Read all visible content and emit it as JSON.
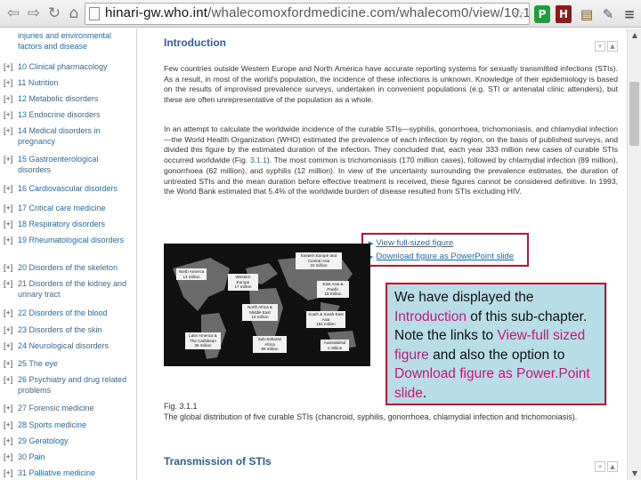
{
  "browser": {
    "url_host": "hinari-gw.who.int",
    "url_path": "/whalecomoxfordmedicine.com/whalecom0/view/10.1093/m",
    "ext_p_label": "P",
    "ext_h_label": "H"
  },
  "sidebar": {
    "expander": "[+]",
    "top_fragment": "injuries and environmental factors and disease",
    "items": [
      {
        "label": "10 Clinical pharmacology"
      },
      {
        "label": "11 Nutrition"
      },
      {
        "label": "12 Metabolic disorders"
      },
      {
        "label": "13 Endocrine disorders"
      },
      {
        "label": "14 Medical disorders in pregnancy"
      },
      {
        "label": "15 Gastroenterological disorders"
      },
      {
        "label": "16 Cardiovascular disorders"
      },
      {
        "label": "17 Critical care medicine"
      },
      {
        "label": "18 Respiratory disorders"
      },
      {
        "label": "19 Rheumatological disorders"
      },
      {
        "label": "20 Disorders of the skeleton"
      },
      {
        "label": "21 Disorders of the kidney and urinary tract"
      },
      {
        "label": "22 Disorders of the blood"
      },
      {
        "label": "23 Disorders of the skin"
      },
      {
        "label": "24 Neurological disorders"
      },
      {
        "label": "25 The eye"
      },
      {
        "label": "26 Psychiatry and drug related problems"
      },
      {
        "label": "27 Forensic medicine"
      },
      {
        "label": "28 Sports medicine"
      },
      {
        "label": "29 Geratology"
      },
      {
        "label": "30 Pain"
      },
      {
        "label": "31 Palliative medicine"
      }
    ]
  },
  "content": {
    "intro_title": "Introduction",
    "para1": "Few countries outside Western Europe and North America have accurate reporting systems for sexually transmitted infections (STIs). As a result, in most of the world's population, the incidence of these infections is unknown. Knowledge of their epidemiology is based on the results of improvised prevalence surveys, undertaken in convenient populations (e.g. STI or antenatal clinic attenders), but these are often unrepresentative of the population as a whole.",
    "para2_before": "In an attempt to calculate the worldwide incidence of the curable STIs—syphilis, gonorrhoea, trichomoniasis, and chlamydial infection—the World Health Organization (WHO) estimated the prevalence of each infection by region, on the basis of published surveys, and divided this figure by the estimated duration of the infection. They concluded that, each year 333 million new cases of curable STIs occurred worldwide (Fig. ",
    "para2_link": "3.1.1",
    "para2_after": "). The most common is trichomoniasis (170 million cases), followed by chlamydial infection (89 million), gonorrhoea (62 million), and syphilis (12 million). In view of the uncertainty surrounding the prevalence estimates, the duration of untreated STIs and the mean duration before effective treatment is received, these figures cannot be considered definitive. In 1993, the World Bank estimated that 5.4% of the worldwide burden of disease resulted from STIs excluding HIV.",
    "link_view": "View full-sized figure",
    "link_download": "Download figure as PowerPoint slide",
    "fig_number": "Fig. 3.1.1",
    "fig_caption": "The global distribution of five curable STIs (chancroid, syphilis, gonorrhoea, chlamydial infection and trichomoniasis).",
    "transmission_title": "Transmission of STIs"
  },
  "map": {
    "regions": [
      {
        "name": "North America",
        "value": "14 million"
      },
      {
        "name": "Western Europe",
        "value": "17 million"
      },
      {
        "name": "Eastern Europe and Central Asia",
        "value": "22 million"
      },
      {
        "name": "East Asia & Pacific",
        "value": "18 million"
      },
      {
        "name": "North Africa & Middle East",
        "value": "10 million"
      },
      {
        "name": "South & South-East Asia",
        "value": "151 million"
      },
      {
        "name": "Latin America & The Caribbean",
        "value": "38 million"
      },
      {
        "name": "Sub-Saharan Africa",
        "value": "69 million"
      },
      {
        "name": "Australia/NZ",
        "value": "1 million"
      }
    ]
  },
  "callout": {
    "t1": "We have displayed the ",
    "h1": "Introduction",
    "t2": " of this sub-chapter.  Note the links to ",
    "h2": "View-full sized figure",
    "t3": " and also the option to ",
    "h3": "Download figure as Power.Point slide",
    "t4": "."
  },
  "colors": {
    "link": "#2a6ab0",
    "heading": "#2f5e9e",
    "callout_bg": "#b8dde6",
    "callout_border": "#c8102e",
    "callout_highlight": "#c2187a"
  }
}
